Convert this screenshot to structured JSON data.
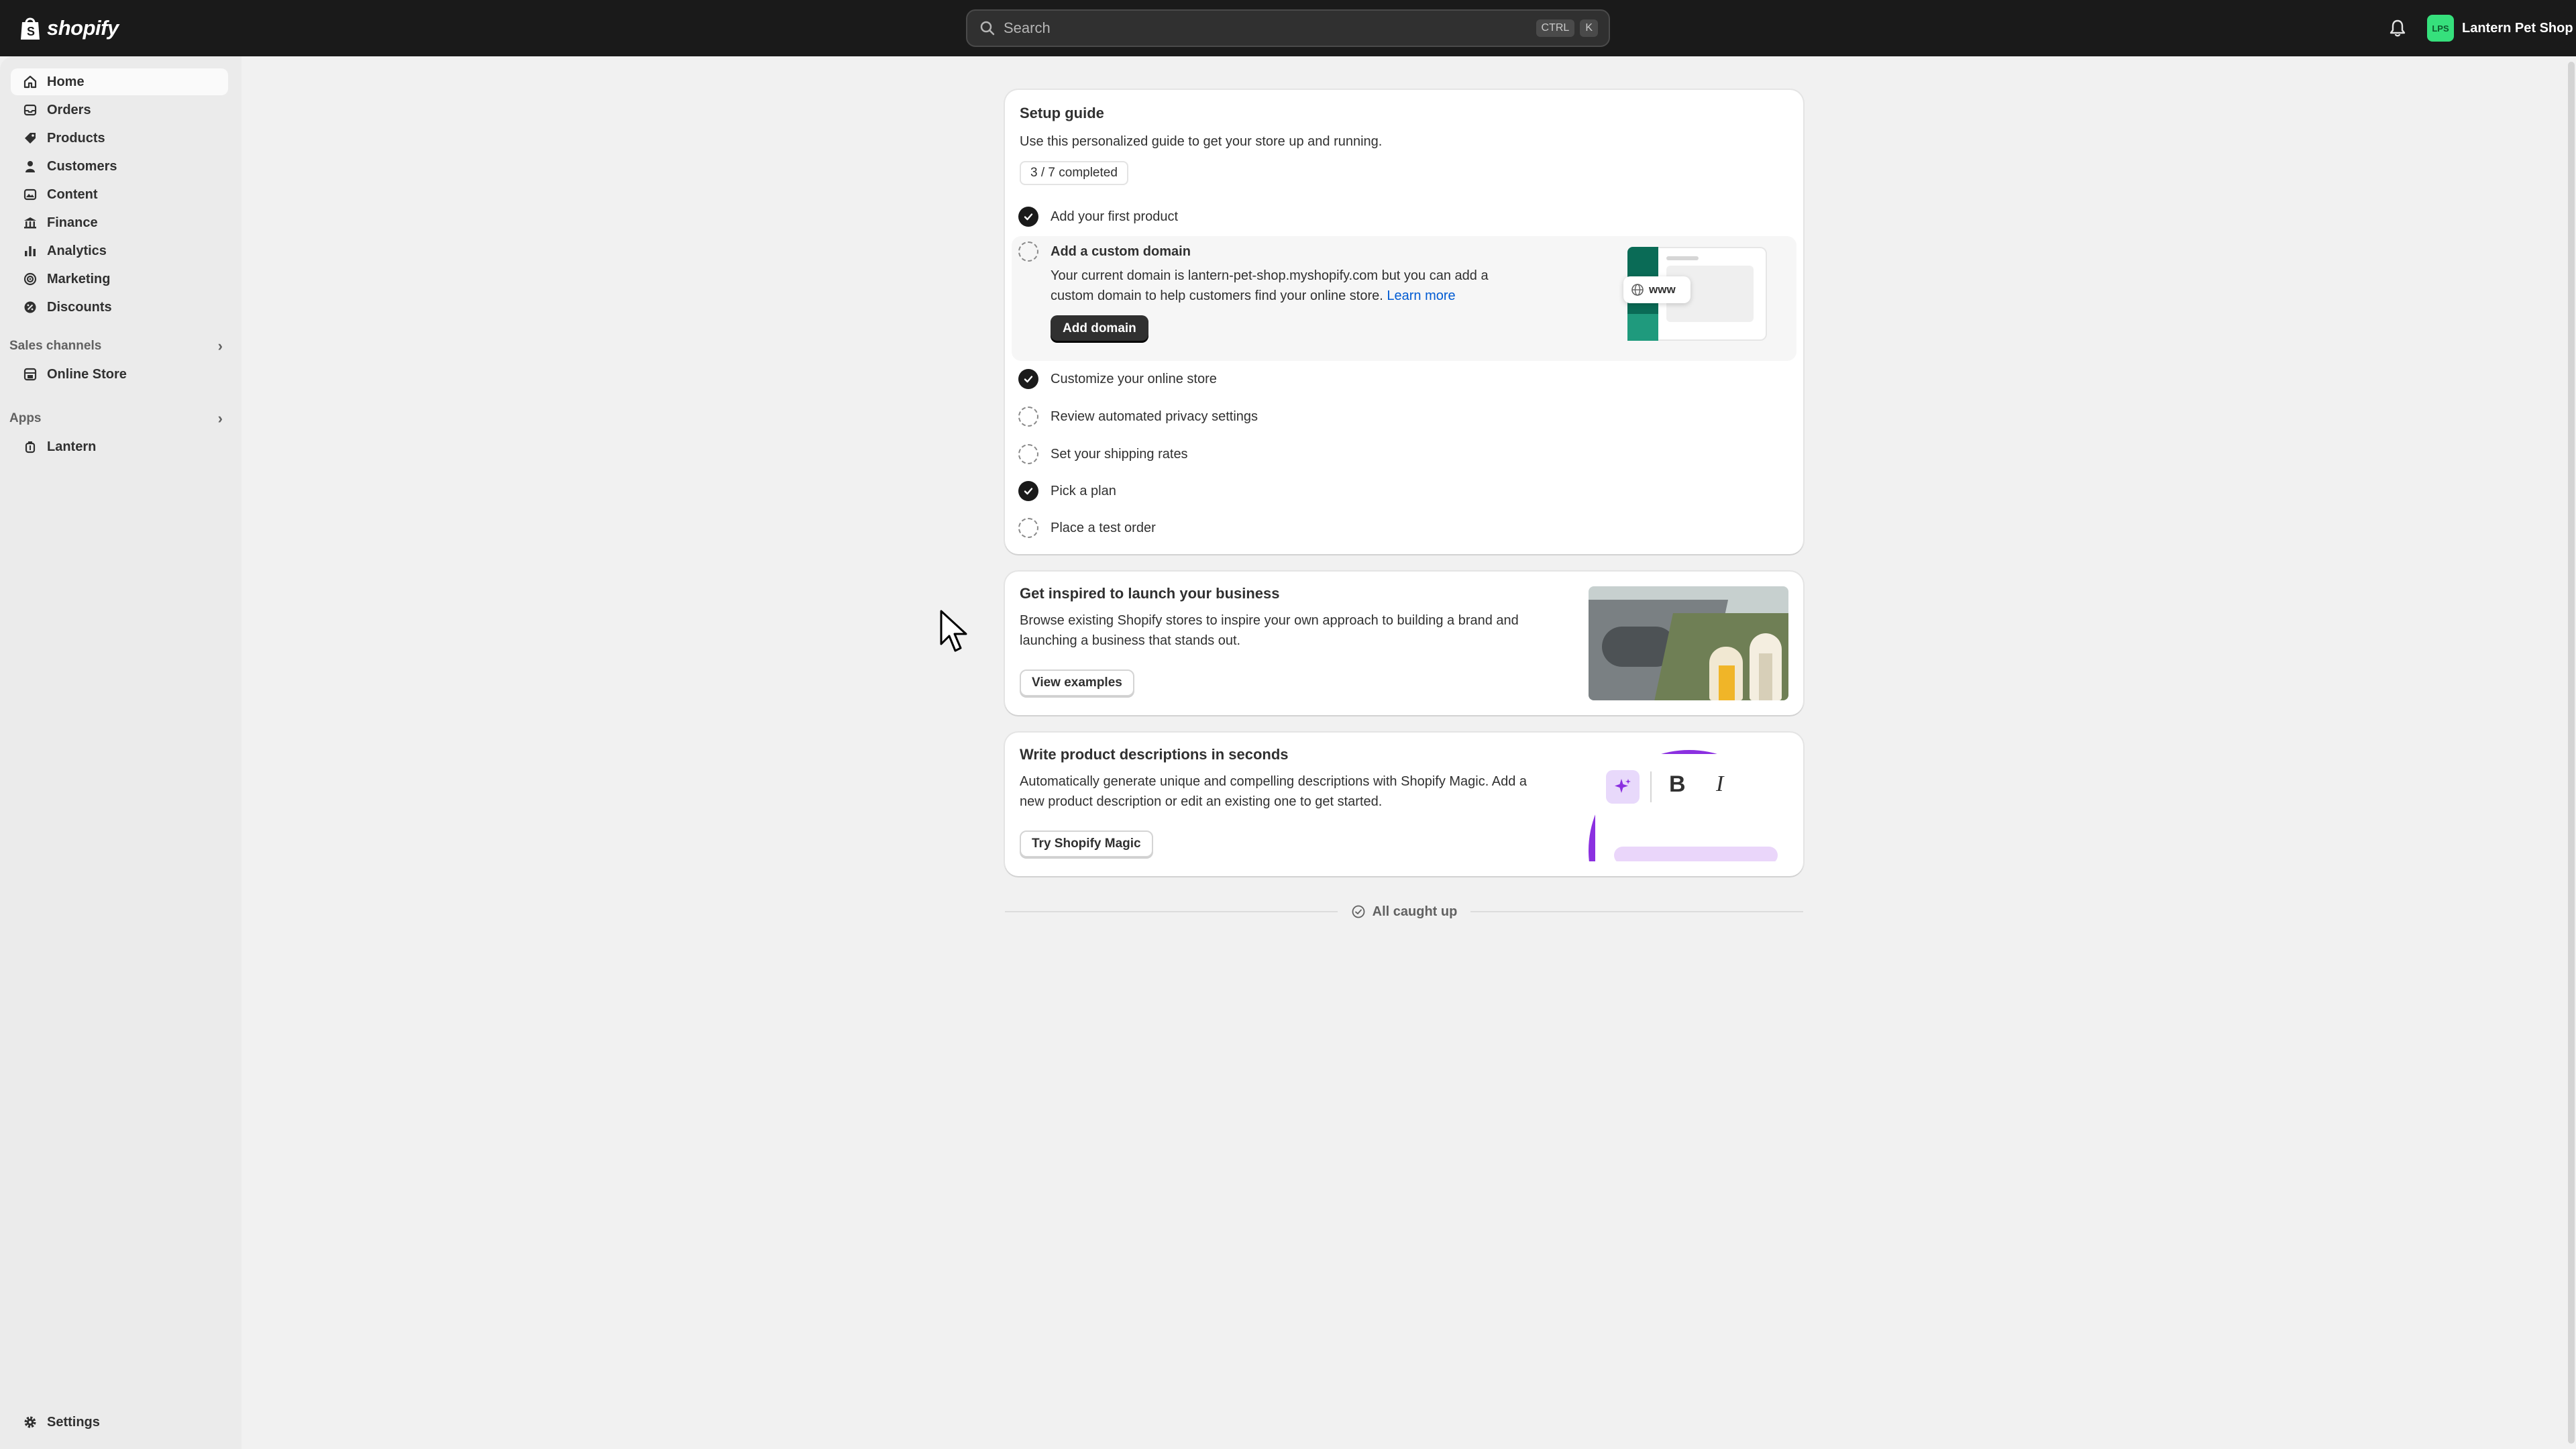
{
  "topbar": {
    "logo_text": "shopify",
    "search_placeholder": "Search",
    "kbd_ctrl": "CTRL",
    "kbd_k": "K",
    "store_initials": "LPS",
    "store_name": "Lantern Pet Shop"
  },
  "sidebar": {
    "items": [
      {
        "label": "Home",
        "icon": "home-icon"
      },
      {
        "label": "Orders",
        "icon": "orders-icon"
      },
      {
        "label": "Products",
        "icon": "tag-icon"
      },
      {
        "label": "Customers",
        "icon": "person-icon"
      },
      {
        "label": "Content",
        "icon": "content-icon"
      },
      {
        "label": "Finance",
        "icon": "bank-icon"
      },
      {
        "label": "Analytics",
        "icon": "bar-chart-icon"
      },
      {
        "label": "Marketing",
        "icon": "target-icon"
      },
      {
        "label": "Discounts",
        "icon": "discount-icon"
      }
    ],
    "sales_channels_title": "Sales channels",
    "online_store": "Online Store",
    "apps_title": "Apps",
    "app_lantern": "Lantern",
    "settings": "Settings"
  },
  "setup_guide": {
    "title": "Setup guide",
    "subtitle": "Use this personalized guide to get your store up and running.",
    "progress": "3 / 7 completed",
    "tasks": [
      {
        "label": "Add your first product",
        "done": true
      },
      {
        "label": "Add a custom domain",
        "done": false
      },
      {
        "label": "Customize your online store",
        "done": true
      },
      {
        "label": "Review automated privacy settings",
        "done": false
      },
      {
        "label": "Set your shipping rates",
        "done": false
      },
      {
        "label": "Pick a plan",
        "done": true
      },
      {
        "label": "Place a test order",
        "done": false
      }
    ],
    "domain_desc_1": "Your current domain is lantern-pet-shop.myshopify.com but you can add a",
    "domain_desc_2": "custom domain to help customers find your online store.",
    "learn_more": "Learn more",
    "add_domain": "Add domain",
    "illus_www": "www"
  },
  "inspire": {
    "title": "Get inspired to launch your business",
    "desc_1": "Browse existing Shopify stores to inspire your own approach to building a brand and",
    "desc_2": "launching a business that stands out.",
    "button": "View examples"
  },
  "magic": {
    "title": "Write product descriptions in seconds",
    "desc_1": "Automatically generate unique and compelling descriptions with Shopify Magic. Add a",
    "desc_2": "new product description or edit an existing one to get started.",
    "button": "Try Shopify Magic",
    "illus_bold": "B",
    "illus_italic": "I"
  },
  "footer": {
    "caught_up": "All caught up"
  },
  "colors": {
    "topbar": "#1a1a1a",
    "sidebar": "#ebebeb",
    "link": "#005bd3",
    "avatar": "#36e07c"
  }
}
